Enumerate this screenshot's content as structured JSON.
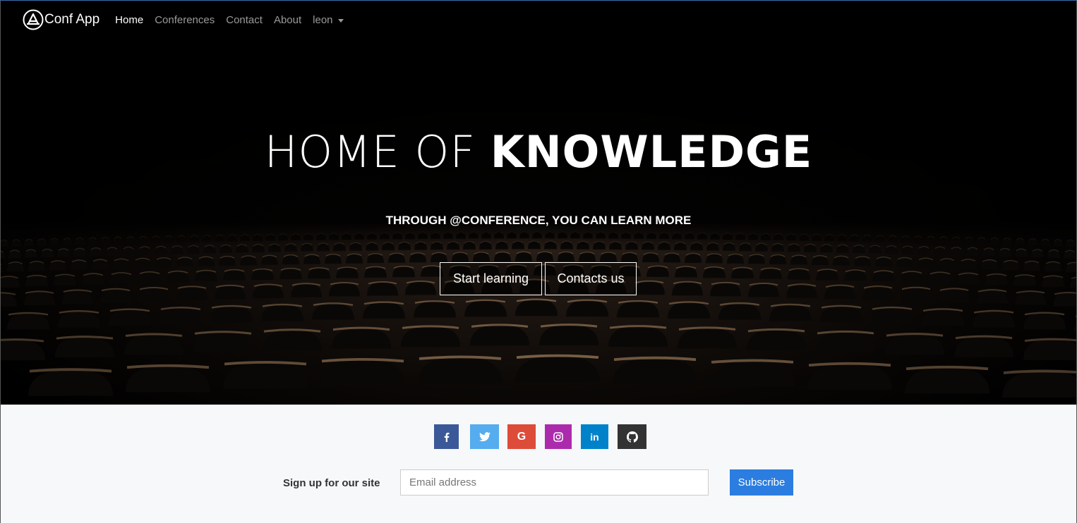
{
  "nav": {
    "brand": "Conf App",
    "items": [
      {
        "label": "Home",
        "active": true
      },
      {
        "label": "Conferences",
        "active": false
      },
      {
        "label": "Contact",
        "active": false
      },
      {
        "label": "About",
        "active": false
      }
    ],
    "user_menu": "leon"
  },
  "hero": {
    "title_light": "HOME OF ",
    "title_bold": "KNOWLEDGE",
    "subtitle": "THROUGH @CONFERENCE, YOU CAN LEARN MORE",
    "buttons": {
      "start": "Start learning",
      "contact": "Contacts us"
    }
  },
  "footer": {
    "socials": [
      {
        "icon": "facebook-icon",
        "glyph": "f",
        "color": "#3b5998"
      },
      {
        "icon": "twitter-icon",
        "glyph": "🐦",
        "color": "#55acee"
      },
      {
        "icon": "google-icon",
        "glyph": "G",
        "color": "#dd4b39"
      },
      {
        "icon": "instagram-icon",
        "glyph": "◎",
        "color": "#ac2bac"
      },
      {
        "icon": "linkedin-icon",
        "glyph": "in",
        "color": "#0082ca"
      },
      {
        "icon": "github-icon",
        "glyph": "⌬",
        "color": "#333333"
      }
    ],
    "signup_label": "Sign up for our site",
    "email_placeholder": "Email address",
    "subscribe_label": "Subscribe"
  },
  "colors": {
    "accent": "#2b7de0",
    "footer_bg": "#f7f8fa"
  }
}
